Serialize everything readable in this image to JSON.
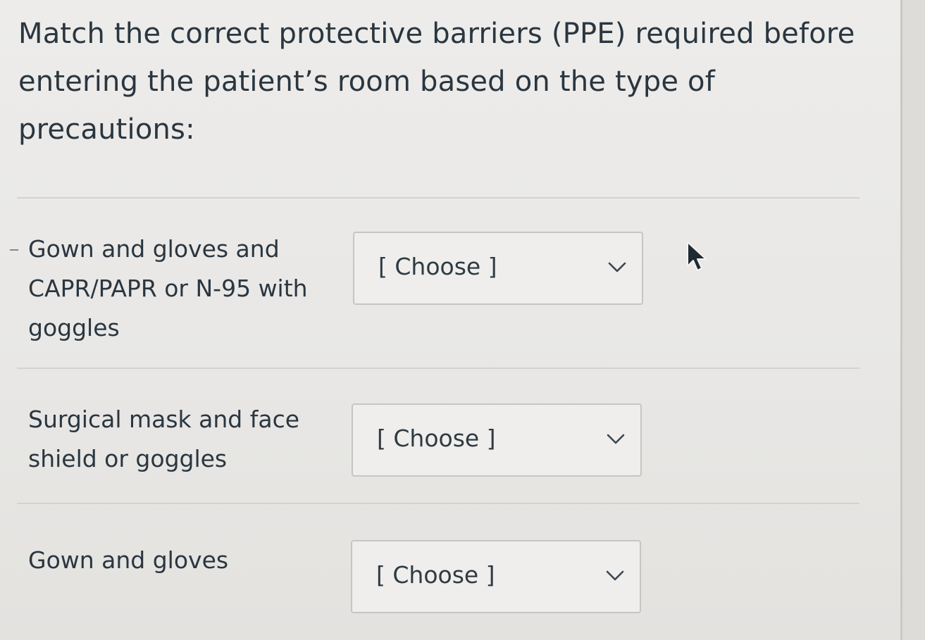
{
  "question": {
    "text": "Match the correct protective barriers (PPE) required before entering the patient’s room based on the type of precautions:"
  },
  "rows": [
    {
      "label": "Gown and gloves and CAPR/PAPR or N-95 with goggles",
      "select_value": "[ Choose ]",
      "icon": "chevron-down-icon"
    },
    {
      "label": "Surgical mask and face shield or goggles",
      "select_value": "[ Choose ]",
      "icon": "chevron-down-icon"
    },
    {
      "label": "Gown and gloves",
      "select_value": "[ Choose ]",
      "icon": "chevron-down-icon"
    }
  ],
  "cursor": {
    "icon": "mouse-pointer-icon"
  }
}
